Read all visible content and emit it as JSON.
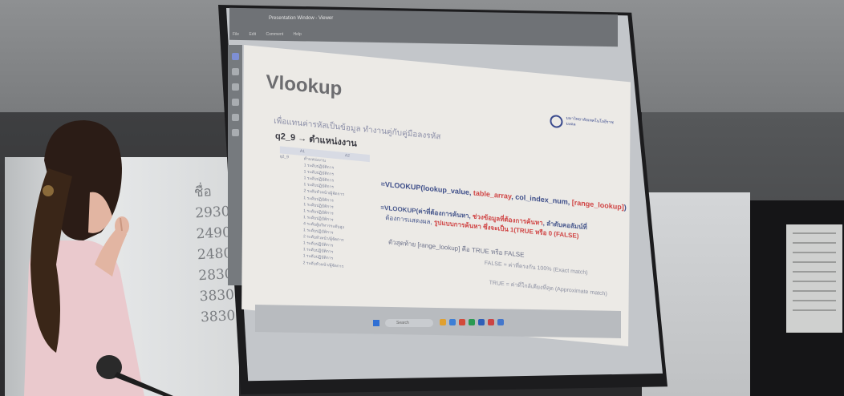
{
  "board": {
    "writing": [
      "ชื่อ",
      "2930",
      "2490",
      "2480",
      "2830",
      "3830",
      "3830"
    ]
  },
  "app": {
    "tab_title": "Presentation Window - Viewer",
    "menu": [
      "File",
      "Edit",
      "Comment",
      "Help"
    ]
  },
  "slide": {
    "title": "Vlookup",
    "logo_text": "มหาวิทยาลัยเทคโนโลยีราชมงคล",
    "subtitle": "เพื่อแทนค่ารหัสเป็นข้อมูล ทำงานคู่กับคู่มือลงรหัส",
    "q_label": "q2_9  → ตำแหน่งงาน",
    "table": {
      "headers": [
        "A1",
        "A2"
      ],
      "rows": [
        [
          "q2_9",
          "ตำแหน่งงาน"
        ],
        [
          "",
          "1 ระดับปฏิบัติการ"
        ],
        [
          "",
          "1 ระดับปฏิบัติการ"
        ],
        [
          "",
          "1 ระดับปฏิบัติการ"
        ],
        [
          "",
          "1 ระดับปฏิบัติการ"
        ],
        [
          "",
          "2 ระดับหัวหน้า/ผู้จัดการ"
        ],
        [
          "",
          "1 ระดับปฏิบัติการ"
        ],
        [
          "",
          "1 ระดับปฏิบัติการ"
        ],
        [
          "",
          "1 ระดับปฏิบัติการ"
        ],
        [
          "",
          "1 ระดับปฏิบัติการ"
        ],
        [
          "",
          "4 ระดับผู้บริหารระดับสูง"
        ],
        [
          "",
          "1 ระดับปฏิบัติการ"
        ],
        [
          "",
          "2 ระดับหัวหน้า/ผู้จัดการ"
        ],
        [
          "",
          "1 ระดับปฏิบัติการ"
        ],
        [
          "",
          "1 ระดับปฏิบัติการ"
        ],
        [
          "",
          "1 ระดับปฏิบัติการ"
        ],
        [
          "",
          "2 ระดับหัวหน้า/ผู้จัดการ"
        ]
      ]
    },
    "formula": {
      "prefix": "=VLOOKUP(lookup_value, ",
      "table_array": "table_array",
      "mid": ", col_index_num, ",
      "range_lookup": "[range_lookup]",
      "suffix": ")"
    },
    "desc1": {
      "prefix": "=VLOOKUP(ค่าที่ต้องการค้นหา, ",
      "red": "ช่วงข้อมูลที่ต้องการค้นหา",
      "suffix": ", ลำดับคอลัมน์ที่"
    },
    "desc2": {
      "prefix": "ต้องการแสดงผล, ",
      "red": "รูปแบบการค้นหา ซึ่งจะเป็น 1(TRUE หรือ 0 (FALSE)"
    },
    "note": "ตัวสุดท้าย [range_lookup] คือ TRUE หรือ FALSE",
    "false_line": "FALSE = ค่าที่ตรงกัน 100% (Exact match)",
    "true_line": "TRUE = ค่าที่ใกล้เคียงที่สุด (Approximate match)"
  },
  "taskbar": {
    "search_placeholder": "Search"
  },
  "colors": {
    "formula_blue": "#3f4f8a",
    "highlight_red": "#d04545",
    "slide_bg": "#eceae6"
  }
}
